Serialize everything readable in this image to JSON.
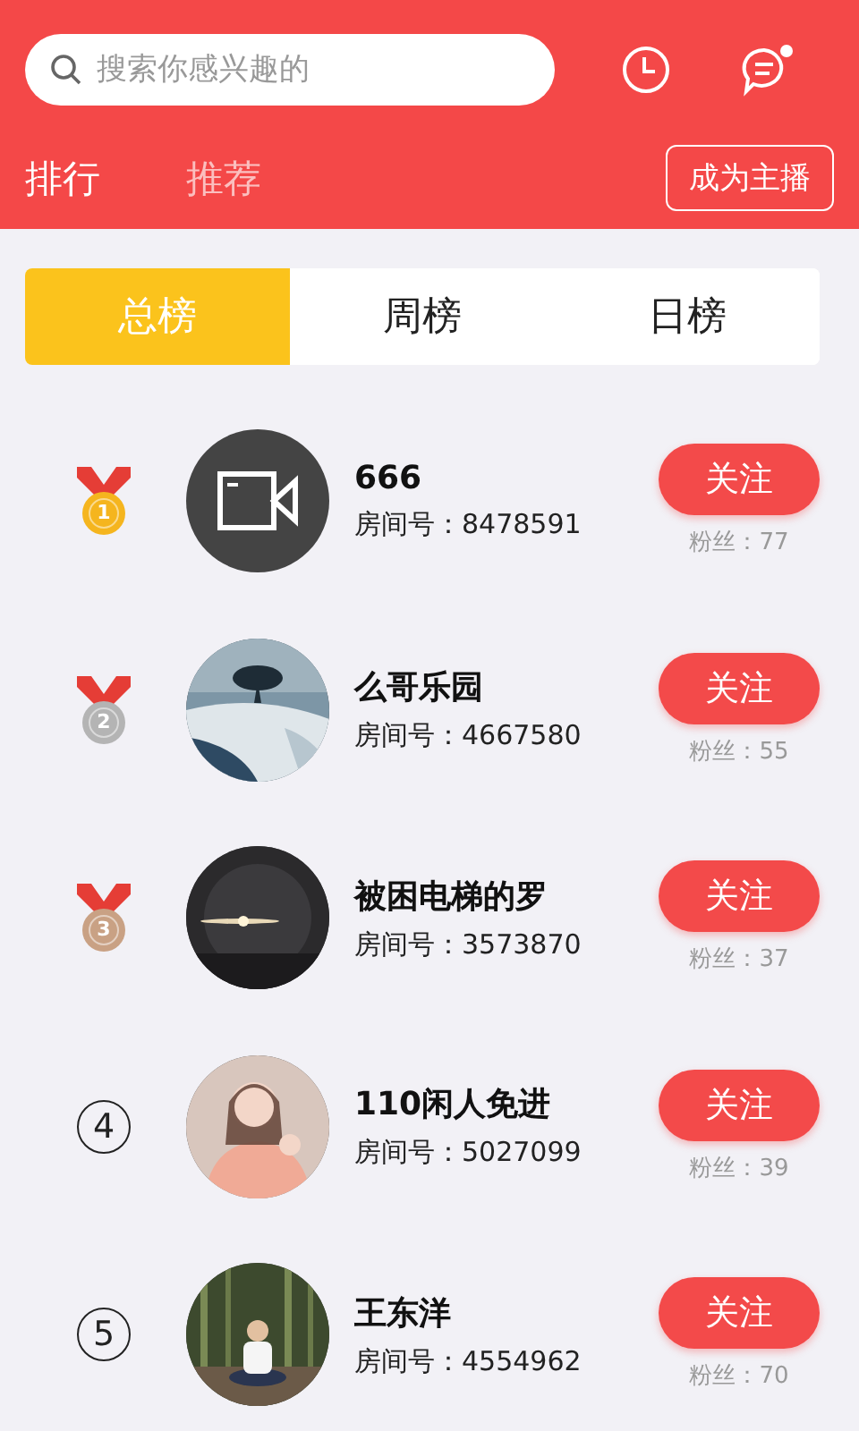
{
  "header": {
    "search": {
      "placeholder": "搜索你感兴趣的"
    },
    "messages": {
      "unread": true
    },
    "tabs": [
      {
        "label": "排行",
        "selected": true
      },
      {
        "label": "推荐",
        "selected": false
      }
    ],
    "become_host_button": "成为主播"
  },
  "segments": [
    {
      "label": "总榜",
      "selected": true
    },
    {
      "label": "周榜",
      "selected": false
    },
    {
      "label": "日榜",
      "selected": false
    }
  ],
  "ranking": [
    {
      "rank": "1",
      "kind": "medal",
      "color": "#f5b51e",
      "avatar": {
        "kind": "icon"
      },
      "name": "666",
      "room": "房间号：8478591",
      "follow": "关注",
      "fans": "粉丝：77"
    },
    {
      "rank": "2",
      "kind": "medal",
      "color": "#b4b4b4",
      "name": "么哥乐园",
      "room": "房间号：4667580",
      "follow": "关注",
      "fans": "粉丝：55"
    },
    {
      "rank": "3",
      "kind": "medal",
      "color": "#c9a184",
      "name": "被困电梯的罗",
      "room": "房间号：3573870",
      "follow": "关注",
      "fans": "粉丝：37"
    },
    {
      "rank": "4",
      "kind": "circle",
      "name": "110闲人免进",
      "room": "房间号：5027099",
      "follow": "关注",
      "fans": "粉丝：39"
    },
    {
      "rank": "5",
      "kind": "circle",
      "name": "王东洋",
      "room": "房间号：4554962",
      "follow": "关注",
      "fans": "粉丝：70"
    }
  ]
}
